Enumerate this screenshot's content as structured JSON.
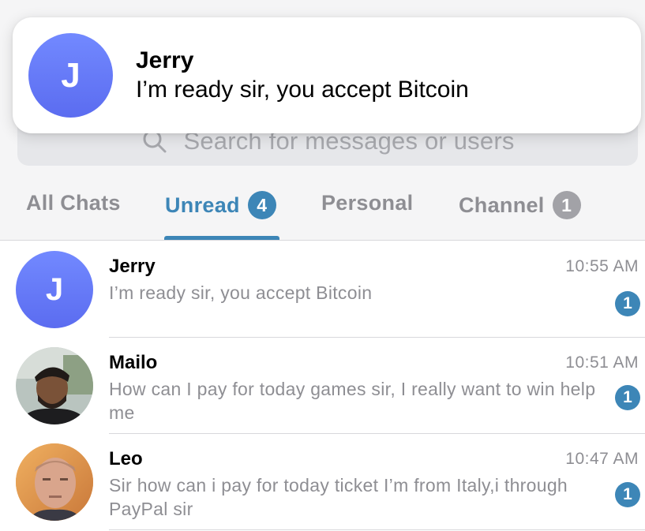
{
  "notification": {
    "avatar_letter": "J",
    "title": "Jerry",
    "body": "I’m ready sir, you accept Bitcoin"
  },
  "search": {
    "placeholder": "Search for messages or users",
    "icon": "search-icon"
  },
  "tabs": [
    {
      "label": "All Chats",
      "badge": null,
      "active": false
    },
    {
      "label": "Unread",
      "badge": "4",
      "active": true
    },
    {
      "label": "Personal",
      "badge": null,
      "active": false
    },
    {
      "label": "Channel",
      "badge": "1",
      "active": false
    }
  ],
  "chats": [
    {
      "name": "Jerry",
      "avatar_letter": "J",
      "time": "10:55 AM",
      "preview": "I’m ready sir, you accept Bitcoin",
      "unread": "1"
    },
    {
      "name": "Mailo",
      "time": "10:51 AM",
      "preview": "How can I pay for today games sir, I really want to win help me",
      "unread": "1"
    },
    {
      "name": "Leo",
      "time": "10:47 AM",
      "preview": "Sir how can i pay for today ticket I’m from Italy,i through PayPal sir",
      "unread": "1"
    }
  ],
  "colors": {
    "accent": "#3d86b7",
    "avatar_gradient_top": "#7289ff",
    "avatar_gradient_bottom": "#5b6cf0",
    "secondary_text": "#8e8e93"
  }
}
